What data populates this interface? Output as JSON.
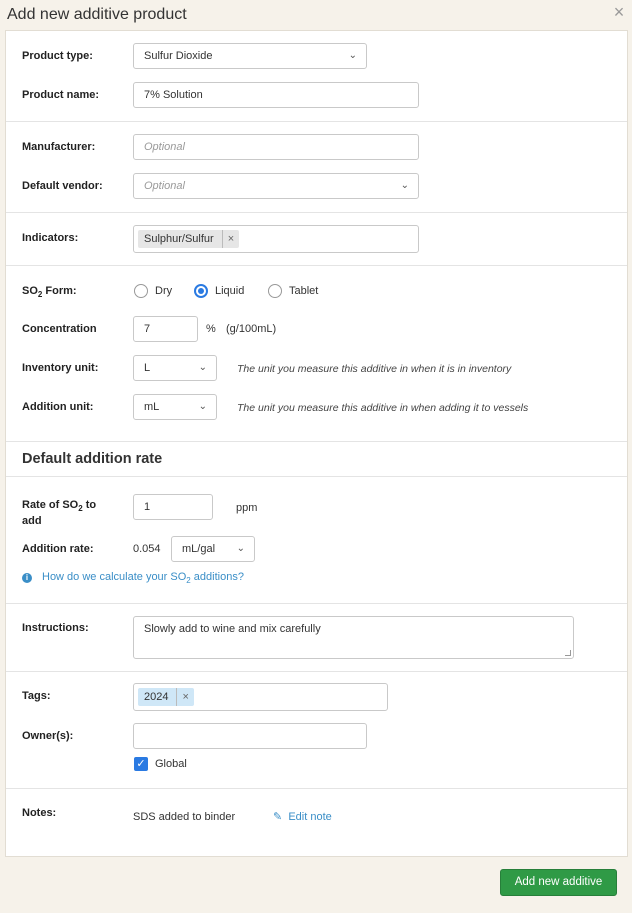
{
  "dialog": {
    "title": "Add new additive product",
    "close_glyph": "×"
  },
  "product_type": {
    "label": "Product type:",
    "value": "Sulfur Dioxide"
  },
  "product_name": {
    "label": "Product name:",
    "value": "7% Solution"
  },
  "manufacturer": {
    "label": "Manufacturer:",
    "placeholder": "Optional"
  },
  "default_vendor": {
    "label": "Default vendor:",
    "placeholder": "Optional"
  },
  "indicators": {
    "label": "Indicators:",
    "chips": [
      "Sulphur/Sulfur"
    ]
  },
  "so2_form": {
    "label_prefix": "SO",
    "label_sub": "2",
    "label_suffix": " Form:",
    "options": [
      "Dry",
      "Liquid",
      "Tablet"
    ],
    "selected": "Liquid"
  },
  "concentration": {
    "label": "Concentration",
    "value": "7",
    "unit": "%",
    "unit_detail": "(g/100mL)"
  },
  "inventory_unit": {
    "label": "Inventory unit:",
    "value": "L",
    "hint": "The unit you measure this additive in when it is in inventory"
  },
  "addition_unit": {
    "label": "Addition unit:",
    "value": "mL",
    "hint": "The unit you measure this additive in when adding it to vessels"
  },
  "default_rate": {
    "heading": "Default addition rate",
    "rate_label_prefix": "Rate of SO",
    "rate_label_sub": "2",
    "rate_label_suffix": " to",
    "rate_label_line2": "add",
    "rate_value": "1",
    "rate_unit": "ppm",
    "addition_rate_label": "Addition rate:",
    "addition_rate_value": "0.054",
    "addition_rate_unit": "mL/gal",
    "help_prefix": "How do we calculate your SO",
    "help_sub": "2",
    "help_suffix": " additions?"
  },
  "instructions": {
    "label": "Instructions:",
    "value": "Slowly add to wine and mix carefully"
  },
  "tags": {
    "label": "Tags:",
    "chips": [
      "2024"
    ]
  },
  "owners": {
    "label": "Owner(s):",
    "value": "",
    "global_label": "Global",
    "global_checked": true
  },
  "notes": {
    "label": "Notes:",
    "value": "SDS added to binder",
    "edit_label": "Edit note"
  },
  "footer": {
    "submit_label": "Add new additive"
  },
  "colors": {
    "primary": "#2f9a46",
    "accent": "#2a7ae2",
    "link": "#3a8ec7",
    "tag_chip": "#cfe7f7",
    "indicator_chip": "#e6e6e6"
  }
}
